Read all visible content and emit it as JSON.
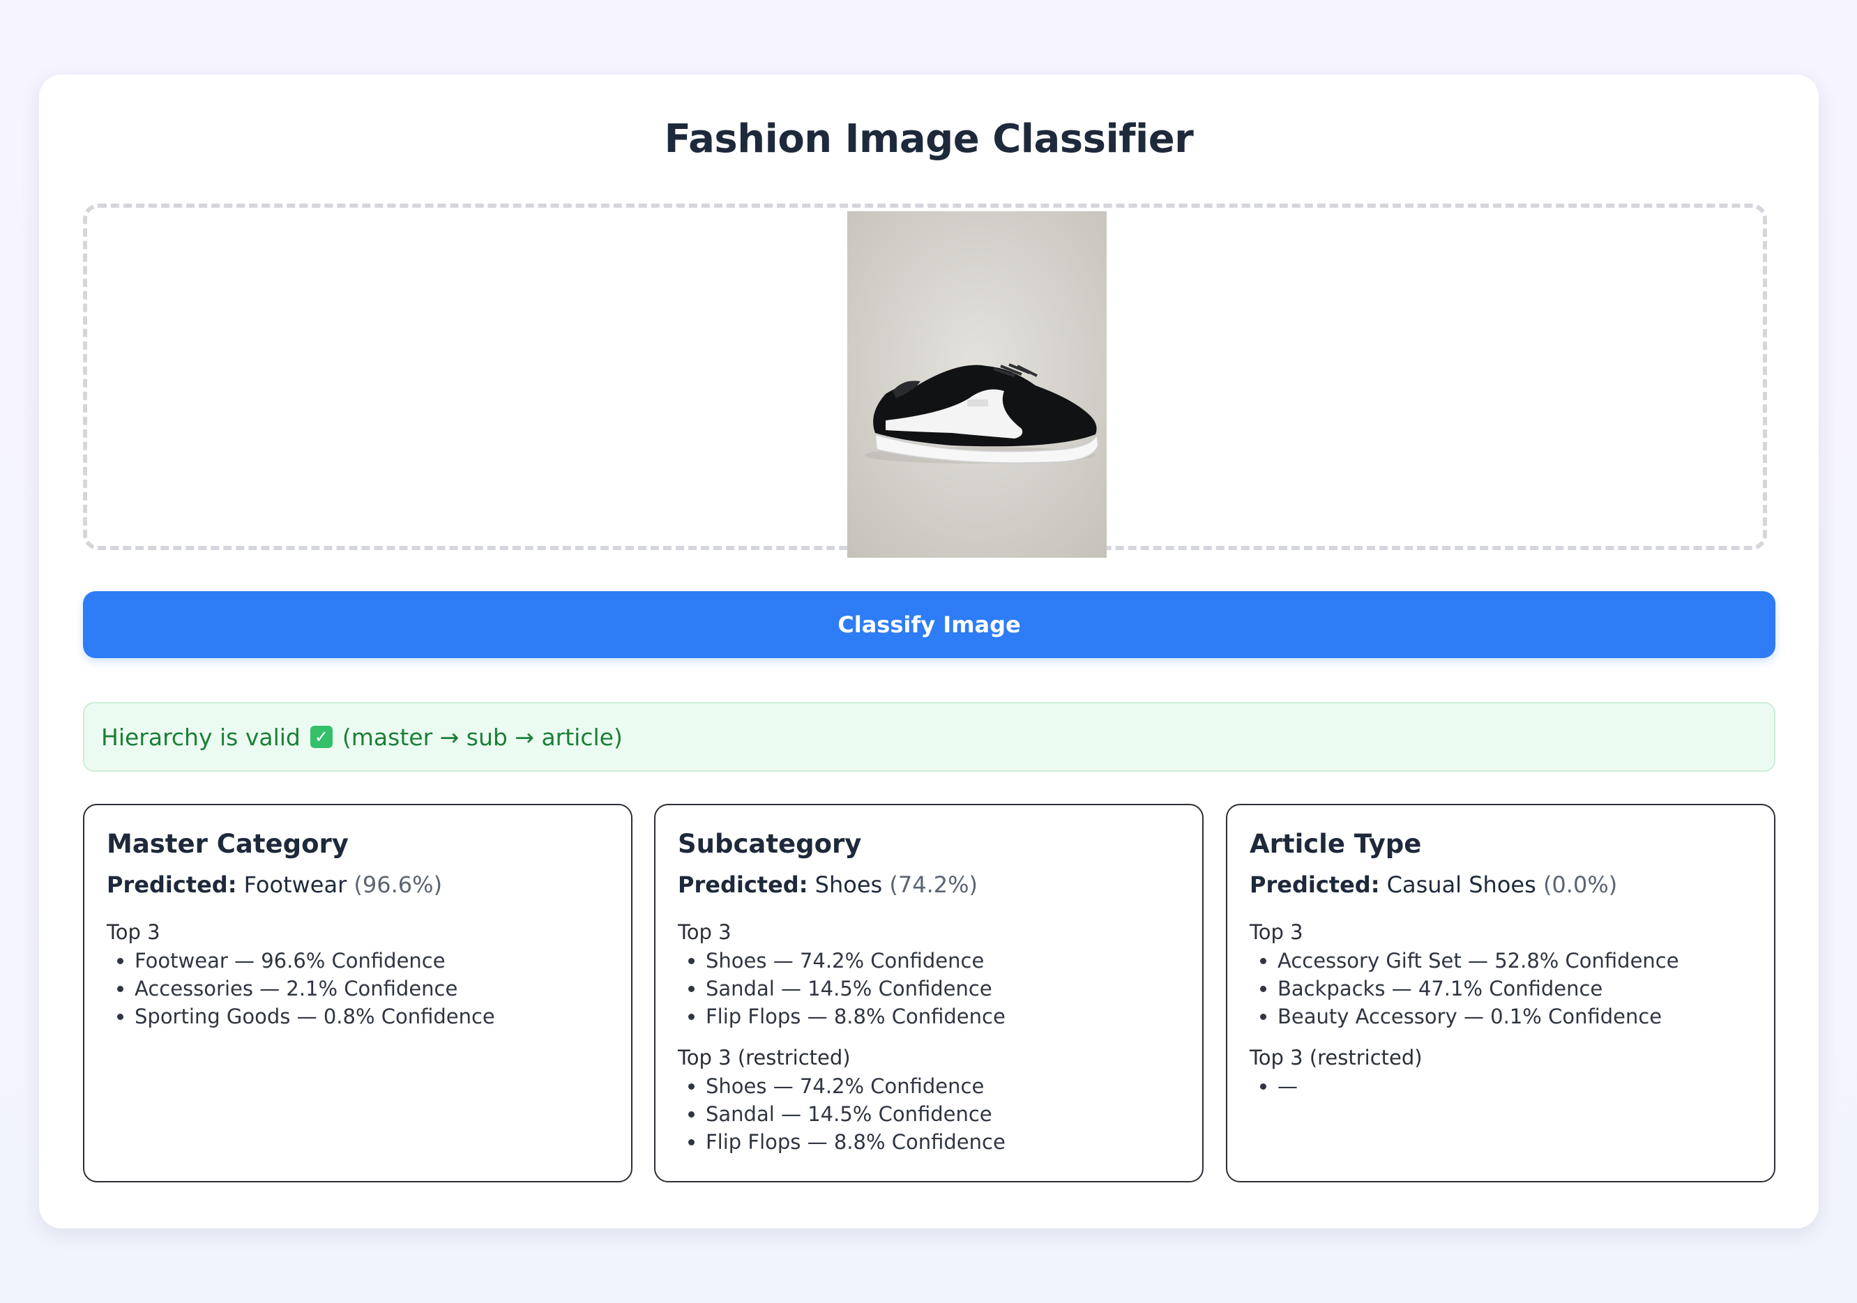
{
  "app": {
    "title": "Fashion Image Classifier"
  },
  "uploader": {
    "image_alt": "Black leather sneaker with white stripe"
  },
  "actions": {
    "classify_label": "Classify Image"
  },
  "status": {
    "text_before": "Hierarchy is valid",
    "text_after": "(master → sub → article)",
    "color": "#1a7f37",
    "icon": "check-box-icon"
  },
  "panels": [
    {
      "heading": "Master Category",
      "predicted_label": "Predicted:",
      "predicted_value": "Footwear",
      "predicted_conf": "(96.6%)",
      "top_title": "Top 3",
      "top": [
        "Footwear — 96.6% Confidence",
        "Accessories — 2.1% Confidence",
        "Sporting Goods — 0.8% Confidence"
      ]
    },
    {
      "heading": "Subcategory",
      "predicted_label": "Predicted:",
      "predicted_value": "Shoes",
      "predicted_conf": "(74.2%)",
      "top_title": "Top 3",
      "top": [
        "Shoes — 74.2% Confidence",
        "Sandal — 14.5% Confidence",
        "Flip Flops — 8.8% Confidence"
      ],
      "restricted_title": "Top 3 (restricted)",
      "restricted": [
        "Shoes — 74.2% Confidence",
        "Sandal — 14.5% Confidence",
        "Flip Flops — 8.8% Confidence"
      ]
    },
    {
      "heading": "Article Type",
      "predicted_label": "Predicted:",
      "predicted_value": "Casual Shoes",
      "predicted_conf": "(0.0%)",
      "top_title": "Top 3",
      "top": [
        "Accessory Gift Set — 52.8% Confidence",
        "Backpacks — 47.1% Confidence",
        "Beauty Accessory — 0.1% Confidence"
      ],
      "restricted_title": "Top 3 (restricted)",
      "restricted": [
        "—"
      ]
    }
  ],
  "colors": {
    "primary": "#2e7cf6",
    "success_bg": "#ecfbf1",
    "success_text": "#1a7f37"
  }
}
